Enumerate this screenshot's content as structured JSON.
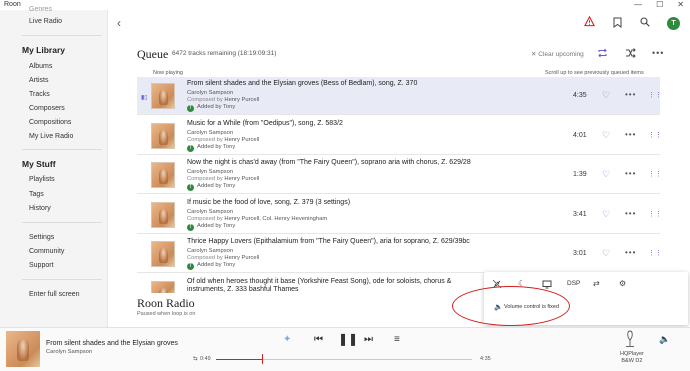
{
  "window": {
    "title": "Roon",
    "controls": [
      "—",
      "☐",
      "✕"
    ]
  },
  "sidebar": {
    "partial_top": "Genres",
    "top_items": [
      {
        "label": "Live Radio"
      }
    ],
    "library_heading": "My Library",
    "library_items": [
      {
        "label": "Albums"
      },
      {
        "label": "Artists"
      },
      {
        "label": "Tracks"
      },
      {
        "label": "Composers"
      },
      {
        "label": "Compositions"
      },
      {
        "label": "My Live Radio"
      }
    ],
    "stuff_heading": "My Stuff",
    "stuff_items": [
      {
        "label": "Playlists"
      },
      {
        "label": "Tags"
      },
      {
        "label": "History"
      }
    ],
    "settings_items": [
      {
        "label": "Settings"
      },
      {
        "label": "Community"
      },
      {
        "label": "Support"
      }
    ],
    "fullscreen": "Enter full screen"
  },
  "header": {
    "avatar_initial": "T"
  },
  "queue": {
    "title": "Queue",
    "subtitle": "6472 tracks remaining (18:19:09:31)",
    "clear_label": "✕ Clear upcoming",
    "now_playing_label": "Now playing",
    "scroll_hint": "Scroll up to see previously queued items",
    "tracks": [
      {
        "title": "From silent shades and the Elysian groves (Bess of Bedlam), song, Z. 370",
        "artist": "Carolyn Sampson",
        "composed_prefix": "Composed by",
        "composer": "Henry Purcell",
        "added_by": "Added by Tony",
        "duration": "4:35"
      },
      {
        "title": "Music for a While (from \"Oedipus\"), song, Z. 583/2",
        "artist": "Carolyn Sampson",
        "composed_prefix": "Composed by",
        "composer": "Henry Purcell",
        "added_by": "Added by Tony",
        "duration": "4:01"
      },
      {
        "title": "Now the night is chas'd away (from \"The Fairy Queen\"), soprano aria with chorus, Z. 629/28",
        "artist": "Carolyn Sampson",
        "composed_prefix": "Composed by",
        "composer": "Henry Purcell",
        "added_by": "Added by Tony",
        "duration": "1:39"
      },
      {
        "title": "If music be the food of love, song, Z. 379 (3 settings)",
        "artist": "Carolyn Sampson",
        "composed_prefix": "Composed by",
        "composer": "Henry Purcell, Col. Henry Heveningham",
        "added_by": "Added by Tony",
        "duration": "3:41"
      },
      {
        "title": "Thrice Happy Lovers (Epithalamium from \"The Fairy Queen\"), aria for soprano, Z. 629/39bc",
        "artist": "Carolyn Sampson",
        "composed_prefix": "Composed by",
        "composer": "Henry Purcell",
        "added_by": "Added by Tony",
        "duration": "3:01"
      },
      {
        "title": "Of old when heroes thought it base (Yorkshire Feast Song), ode for soloists, chorus & instruments, Z. 333",
        "artist": "",
        "composed_prefix": "",
        "composer": "",
        "added_by": "",
        "duration": ""
      }
    ],
    "partial_last_line": "bashful Thames"
  },
  "radio": {
    "title": "Roon Radio",
    "subtitle": "Paused when loop is on"
  },
  "popup": {
    "dsp_label": "DSP",
    "message": "Volume control is fixed"
  },
  "player": {
    "title": "From silent shades and the Elysian groves",
    "artist": "Carolyn Sampson",
    "elapsed": "0:49",
    "total": "4:35",
    "progress": 0.18,
    "zone_line1": "HQPlayer",
    "zone_line2": "B&W D2"
  }
}
